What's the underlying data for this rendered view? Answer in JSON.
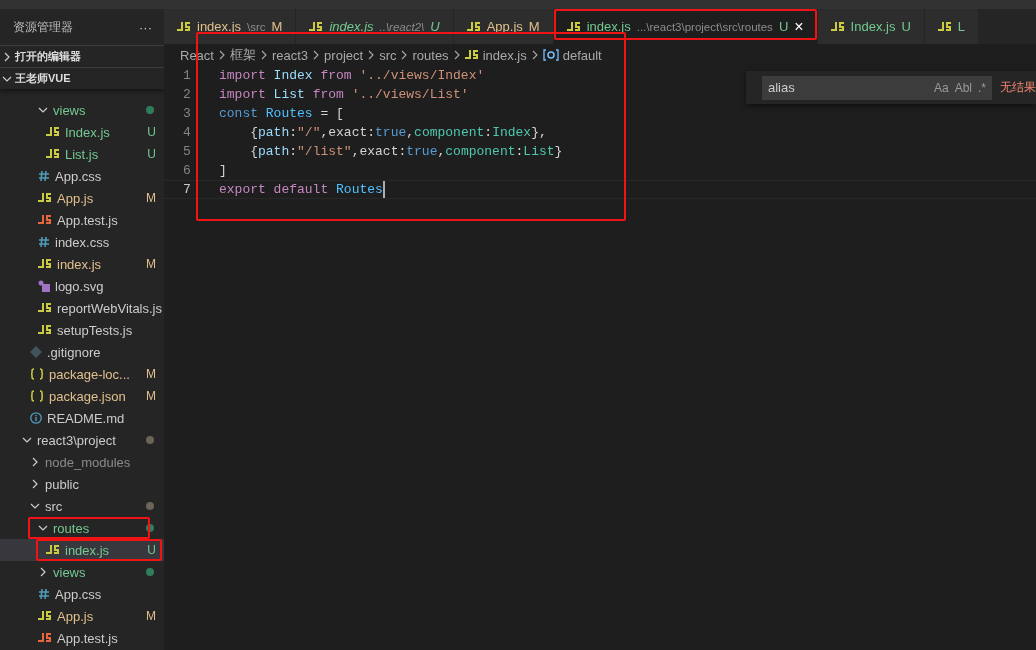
{
  "sidebar": {
    "title": "资源管理器",
    "more": "···",
    "sections": [
      {
        "label": "打开的编辑器",
        "expanded": false
      },
      {
        "label": "王老师VUE",
        "expanded": true
      }
    ],
    "tree": [
      {
        "children": [
          {
            "children": [
              {
                "name": "views",
                "kind": "folder",
                "expanded": true,
                "untracked": true,
                "modified": false,
                "ignored": false,
                "color": "#2f7d5a",
                "selected": false,
                "highlighted": false,
                "children": [
                  {
                    "name": "Index.js",
                    "kind": "js",
                    "untracked": true,
                    "modified": false,
                    "ignored": false,
                    "badge": "U",
                    "selected": false,
                    "highlighted": false
                  },
                  {
                    "name": "List.js",
                    "kind": "js",
                    "untracked": true,
                    "modified": false,
                    "ignored": false,
                    "badge": "U",
                    "selected": false,
                    "highlighted": false
                  }
                ]
              },
              {
                "name": "App.css",
                "kind": "css",
                "untracked": false,
                "modified": false,
                "ignored": false,
                "selected": false,
                "highlighted": false
              },
              {
                "name": "App.js",
                "kind": "js",
                "untracked": false,
                "modified": true,
                "ignored": false,
                "badge": "M",
                "selected": false,
                "highlighted": false
              },
              {
                "name": "App.test.js",
                "kind": "test",
                "untracked": false,
                "modified": false,
                "ignored": false,
                "selected": false,
                "highlighted": false
              },
              {
                "name": "index.css",
                "kind": "css",
                "untracked": false,
                "modified": false,
                "ignored": false,
                "selected": false,
                "highlighted": false
              },
              {
                "name": "index.js",
                "kind": "js",
                "untracked": false,
                "modified": true,
                "ignored": false,
                "badge": "M",
                "selected": false,
                "highlighted": false
              },
              {
                "name": "logo.svg",
                "kind": "svg",
                "untracked": false,
                "modified": false,
                "ignored": false,
                "selected": false,
                "highlighted": false
              },
              {
                "name": "reportWebVitals.js",
                "kind": "js",
                "untracked": false,
                "modified": false,
                "ignored": false,
                "selected": false,
                "highlighted": false
              },
              {
                "name": "setupTests.js",
                "kind": "js",
                "untracked": false,
                "modified": false,
                "ignored": false,
                "selected": false,
                "highlighted": false
              }
            ]
          },
          {
            "name": ".gitignore",
            "kind": "git",
            "untracked": false,
            "modified": false,
            "ignored": false,
            "selected": false,
            "highlighted": false
          },
          {
            "name": "package-loc...",
            "kind": "json",
            "untracked": false,
            "modified": true,
            "ignored": false,
            "badge": "M",
            "selected": false,
            "highlighted": false
          },
          {
            "name": "package.json",
            "kind": "json",
            "untracked": false,
            "modified": true,
            "ignored": false,
            "badge": "M",
            "selected": false,
            "highlighted": false
          },
          {
            "name": "README.md",
            "kind": "info",
            "untracked": false,
            "modified": false,
            "ignored": false,
            "selected": false,
            "highlighted": false
          }
        ]
      },
      {
        "name": "react3\\project",
        "kind": "folder",
        "expanded": true,
        "untracked": false,
        "modified": false,
        "ignored": false,
        "color": "#6b6457",
        "selected": false,
        "highlighted": false,
        "children": [
          {
            "name": "node_modules",
            "kind": "folder",
            "expanded": false,
            "untracked": false,
            "modified": false,
            "ignored": true,
            "selected": false,
            "highlighted": false
          },
          {
            "name": "public",
            "kind": "folder",
            "expanded": false,
            "untracked": false,
            "modified": false,
            "ignored": false,
            "selected": false,
            "highlighted": false
          },
          {
            "name": "src",
            "kind": "folder",
            "expanded": true,
            "untracked": false,
            "modified": false,
            "ignored": false,
            "color": "#6b6457",
            "selected": false,
            "highlighted": false,
            "children": [
              {
                "name": "routes",
                "kind": "folder",
                "expanded": true,
                "untracked": true,
                "modified": false,
                "ignored": false,
                "color": "#2f7d5a",
                "selected": false,
                "highlighted": true,
                "children": [
                  {
                    "name": "index.js",
                    "kind": "js",
                    "untracked": true,
                    "modified": false,
                    "ignored": false,
                    "badge": "U",
                    "selected": true,
                    "highlighted": true
                  }
                ]
              },
              {
                "name": "views",
                "kind": "folder",
                "expanded": false,
                "untracked": true,
                "modified": false,
                "ignored": false,
                "color": "#2f7d5a",
                "selected": false,
                "highlighted": false
              },
              {
                "name": "App.css",
                "kind": "css",
                "untracked": false,
                "modified": false,
                "ignored": false,
                "selected": false,
                "highlighted": false
              },
              {
                "name": "App.js",
                "kind": "js",
                "untracked": false,
                "modified": true,
                "ignored": false,
                "badge": "M",
                "selected": false,
                "highlighted": false
              },
              {
                "name": "App.test.js",
                "kind": "test",
                "untracked": false,
                "modified": false,
                "ignored": false,
                "selected": false,
                "highlighted": false
              }
            ]
          }
        ]
      }
    ]
  },
  "tabs": [
    {
      "name": "index.js",
      "path": "\\src",
      "badge": "M",
      "untracked": false,
      "italic": false,
      "selected": false,
      "highlighted": false
    },
    {
      "name": "index.js",
      "path": "..\\react2\\",
      "badge": "U",
      "untracked": true,
      "italic": true,
      "selected": false,
      "highlighted": false
    },
    {
      "name": "App.js",
      "badge": "M",
      "untracked": false,
      "italic": false,
      "selected": false,
      "highlighted": false
    },
    {
      "name": "index.js",
      "path": "...\\react3\\project\\src\\routes",
      "badge": "U",
      "untracked": true,
      "italic": false,
      "selected": true,
      "highlighted": true,
      "close": "×"
    },
    {
      "name": "Index.js",
      "badge": "U",
      "untracked": true,
      "italic": false,
      "selected": false,
      "highlighted": false
    },
    {
      "name": "L",
      "untracked": true,
      "italic": false,
      "selected": false,
      "highlighted": false
    }
  ],
  "breadcrumb": [
    {
      "label": "React"
    },
    {
      "label": "框架"
    },
    {
      "label": "react3"
    },
    {
      "label": "project"
    },
    {
      "label": "src"
    },
    {
      "label": "routes"
    },
    {
      "label": "index.js",
      "kind": "js"
    },
    {
      "label": "default",
      "kind": "symbol"
    }
  ],
  "find": {
    "value": "alias",
    "options": [
      "Aa",
      "Abl",
      ".*"
    ],
    "result": "无结果"
  },
  "code": {
    "highlighted": true,
    "lines": [
      {
        "number": "1",
        "active": false,
        "tokens": [
          {
            "kind": "kw",
            "text": "import "
          },
          {
            "kind": "var",
            "text": "Index "
          },
          {
            "kind": "kw",
            "text": "from "
          },
          {
            "kind": "str",
            "text": "'../views/Index'"
          }
        ]
      },
      {
        "number": "2",
        "active": false,
        "tokens": [
          {
            "kind": "kw",
            "text": "import "
          },
          {
            "kind": "var",
            "text": "List "
          },
          {
            "kind": "kw",
            "text": "from "
          },
          {
            "kind": "str",
            "text": "'../views/List'"
          }
        ]
      },
      {
        "number": "3",
        "active": false,
        "tokens": [
          {
            "kind": "decl",
            "text": "const "
          },
          {
            "kind": "const",
            "text": "Routes"
          },
          {
            "kind": "punct",
            "text": " = ["
          }
        ]
      },
      {
        "number": "4",
        "active": false,
        "tokens": [
          {
            "kind": "punct",
            "text": "    {"
          },
          {
            "kind": "prop",
            "text": "path"
          },
          {
            "kind": "punct",
            "text": ":"
          },
          {
            "kind": "str",
            "text": "\"/\""
          },
          {
            "kind": "punct",
            "text": ",exact:"
          },
          {
            "kind": "decl",
            "text": "true"
          },
          {
            "kind": "punct",
            "text": ","
          },
          {
            "kind": "type",
            "text": "component"
          },
          {
            "kind": "punct",
            "text": ":"
          },
          {
            "kind": "type",
            "text": "Index"
          },
          {
            "kind": "punct",
            "text": "},"
          }
        ]
      },
      {
        "number": "5",
        "active": false,
        "tokens": [
          {
            "kind": "punct",
            "text": "    {"
          },
          {
            "kind": "prop",
            "text": "path"
          },
          {
            "kind": "punct",
            "text": ":"
          },
          {
            "kind": "str",
            "text": "\"/list\""
          },
          {
            "kind": "punct",
            "text": ",exact:"
          },
          {
            "kind": "decl",
            "text": "true"
          },
          {
            "kind": "punct",
            "text": ","
          },
          {
            "kind": "type",
            "text": "component"
          },
          {
            "kind": "punct",
            "text": ":"
          },
          {
            "kind": "type",
            "text": "List"
          },
          {
            "kind": "punct",
            "text": "}"
          }
        ]
      },
      {
        "number": "6",
        "active": false,
        "tokens": [
          {
            "kind": "punct",
            "text": "]"
          }
        ]
      },
      {
        "number": "7",
        "active": true,
        "tokens": [
          {
            "kind": "kw",
            "text": "export "
          },
          {
            "kind": "kw",
            "text": "default "
          },
          {
            "kind": "const",
            "text": "Routes"
          }
        ]
      }
    ]
  }
}
